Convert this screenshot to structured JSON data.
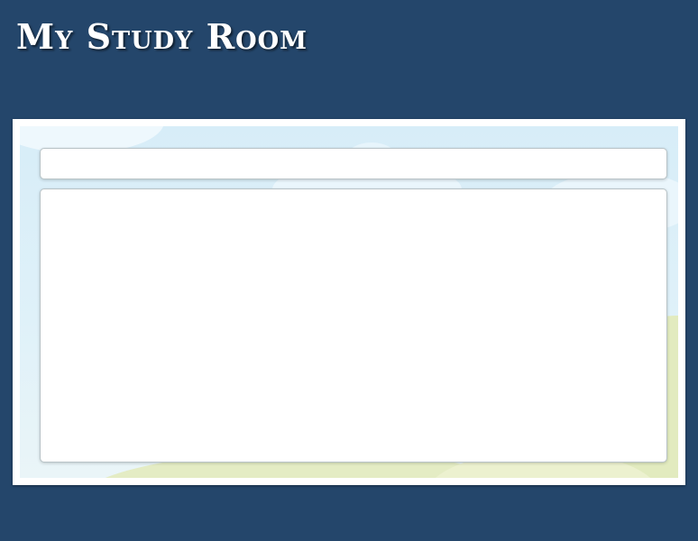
{
  "app": {
    "title": "My Study Room"
  },
  "colors": {
    "background": "#24466b",
    "frame": "#ffffff",
    "sky": "#d7edf8",
    "grass": "#dfe9b8",
    "panel": "#ffffff"
  }
}
